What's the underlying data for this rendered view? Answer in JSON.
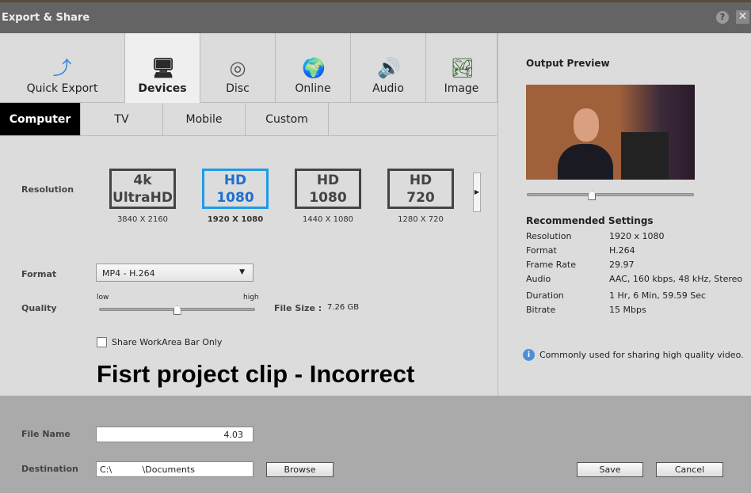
{
  "window": {
    "title": "Export & Share",
    "help": "?",
    "close": "✕"
  },
  "tabs": [
    {
      "label": "Quick Export",
      "icon": "quick-export-icon",
      "glyph": "⤴",
      "color": "#3a8ee0"
    },
    {
      "label": "Devices",
      "icon": "devices-icon",
      "glyph": "🖥",
      "color": "#2a2a2a"
    },
    {
      "label": "Disc",
      "icon": "disc-icon",
      "glyph": "◎",
      "color": "#555"
    },
    {
      "label": "Online",
      "icon": "globe-icon",
      "glyph": "🌍",
      "color": "#3a7ac0"
    },
    {
      "label": "Audio",
      "icon": "speaker-icon",
      "glyph": "🔊",
      "color": "#3a8ee0"
    },
    {
      "label": "Image",
      "icon": "image-icon",
      "glyph": "🏞",
      "color": "#3a6a30"
    }
  ],
  "subtabs": [
    "Computer",
    "TV",
    "Mobile",
    "Custom"
  ],
  "resolution": {
    "label": "Resolution",
    "options": [
      {
        "line1": "4k",
        "line2": "UltraHD",
        "size": "3840 X 2160"
      },
      {
        "line1": "HD",
        "line2": "1080",
        "size": "1920 X 1080"
      },
      {
        "line1": "HD",
        "line2": "1080",
        "size": "1440 X 1080"
      },
      {
        "line1": "HD",
        "line2": "720",
        "size": "1280 X 720"
      }
    ],
    "selected": 1
  },
  "format": {
    "label": "Format",
    "value": "MP4 - H.264"
  },
  "quality": {
    "label": "Quality",
    "low": "low",
    "high": "high",
    "value_fraction": 0.5,
    "file_size_label": "File Size :",
    "file_size": "7.26 GB"
  },
  "share_workarea": {
    "label": "Share WorkArea Bar Only",
    "checked": false
  },
  "annotation": "Fisrt project clip - Incorrect",
  "preview": {
    "title": "Output Preview",
    "position_fraction": 0.39
  },
  "recommended": {
    "title": "Recommended Settings",
    "rows": [
      {
        "k": "Resolution",
        "v": "1920 x 1080"
      },
      {
        "k": "Format",
        "v": "H.264"
      },
      {
        "k": "Frame Rate",
        "v": "29.97"
      },
      {
        "k": "Audio",
        "v": "AAC, 160 kbps, 48 kHz, Stereo"
      },
      {
        "k": "Duration",
        "v": "1 Hr, 6 Min, 59.59 Sec"
      },
      {
        "k": "Bitrate",
        "v": "15 Mbps"
      }
    ],
    "info": "Commonly used for sharing high quality video."
  },
  "file_name": {
    "label": "File Name",
    "value": "4.03"
  },
  "destination": {
    "label": "Destination",
    "value": "C:\\           \\Documents",
    "browse": "Browse"
  },
  "buttons": {
    "save": "Save",
    "cancel": "Cancel"
  }
}
